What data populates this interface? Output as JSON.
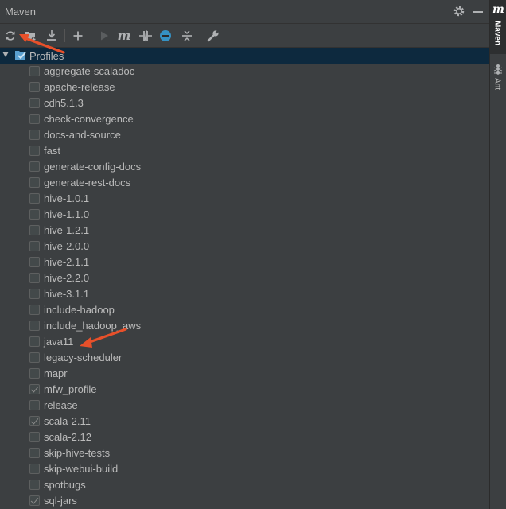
{
  "panel": {
    "title": "Maven"
  },
  "toolbar": {
    "buttons": [
      {
        "icon": "reload-icon"
      },
      {
        "icon": "add-maven-project-icon"
      },
      {
        "icon": "download-icon"
      },
      {
        "icon": "plus-icon"
      },
      {
        "icon": "run-icon"
      },
      {
        "icon": "maven-goal-icon",
        "glyph": "m"
      },
      {
        "icon": "toggle-offline-icon"
      },
      {
        "icon": "skip-tests-icon"
      },
      {
        "icon": "show-dependencies-icon"
      },
      {
        "icon": "wrench-icon"
      }
    ]
  },
  "tree": {
    "root_label": "Profiles",
    "profiles": [
      {
        "label": "aggregate-scaladoc",
        "checked": false
      },
      {
        "label": "apache-release",
        "checked": false
      },
      {
        "label": "cdh5.1.3",
        "checked": false
      },
      {
        "label": "check-convergence",
        "checked": false
      },
      {
        "label": "docs-and-source",
        "checked": false
      },
      {
        "label": "fast",
        "checked": false
      },
      {
        "label": "generate-config-docs",
        "checked": false
      },
      {
        "label": "generate-rest-docs",
        "checked": false
      },
      {
        "label": "hive-1.0.1",
        "checked": false
      },
      {
        "label": "hive-1.1.0",
        "checked": false
      },
      {
        "label": "hive-1.2.1",
        "checked": false
      },
      {
        "label": "hive-2.0.0",
        "checked": false
      },
      {
        "label": "hive-2.1.1",
        "checked": false
      },
      {
        "label": "hive-2.2.0",
        "checked": false
      },
      {
        "label": "hive-3.1.1",
        "checked": false
      },
      {
        "label": "include-hadoop",
        "checked": false
      },
      {
        "label": "include_hadoop_aws",
        "checked": false
      },
      {
        "label": "java11",
        "checked": false
      },
      {
        "label": "legacy-scheduler",
        "checked": false
      },
      {
        "label": "mapr",
        "checked": false
      },
      {
        "label": "mfw_profile",
        "checked": true
      },
      {
        "label": "release",
        "checked": false
      },
      {
        "label": "scala-2.11",
        "checked": true
      },
      {
        "label": "scala-2.12",
        "checked": false
      },
      {
        "label": "skip-hive-tests",
        "checked": false
      },
      {
        "label": "skip-webui-build",
        "checked": false
      },
      {
        "label": "spotbugs",
        "checked": false
      },
      {
        "label": "sql-jars",
        "checked": true
      }
    ]
  },
  "side_tabs": {
    "maven": {
      "glyph": "m",
      "label": "Maven"
    },
    "ant": {
      "label": "Ant"
    }
  },
  "colors": {
    "panel_bg": "#3c3f41",
    "selection_bg": "#0d293e",
    "annotation_arrow": "#e8502a"
  }
}
